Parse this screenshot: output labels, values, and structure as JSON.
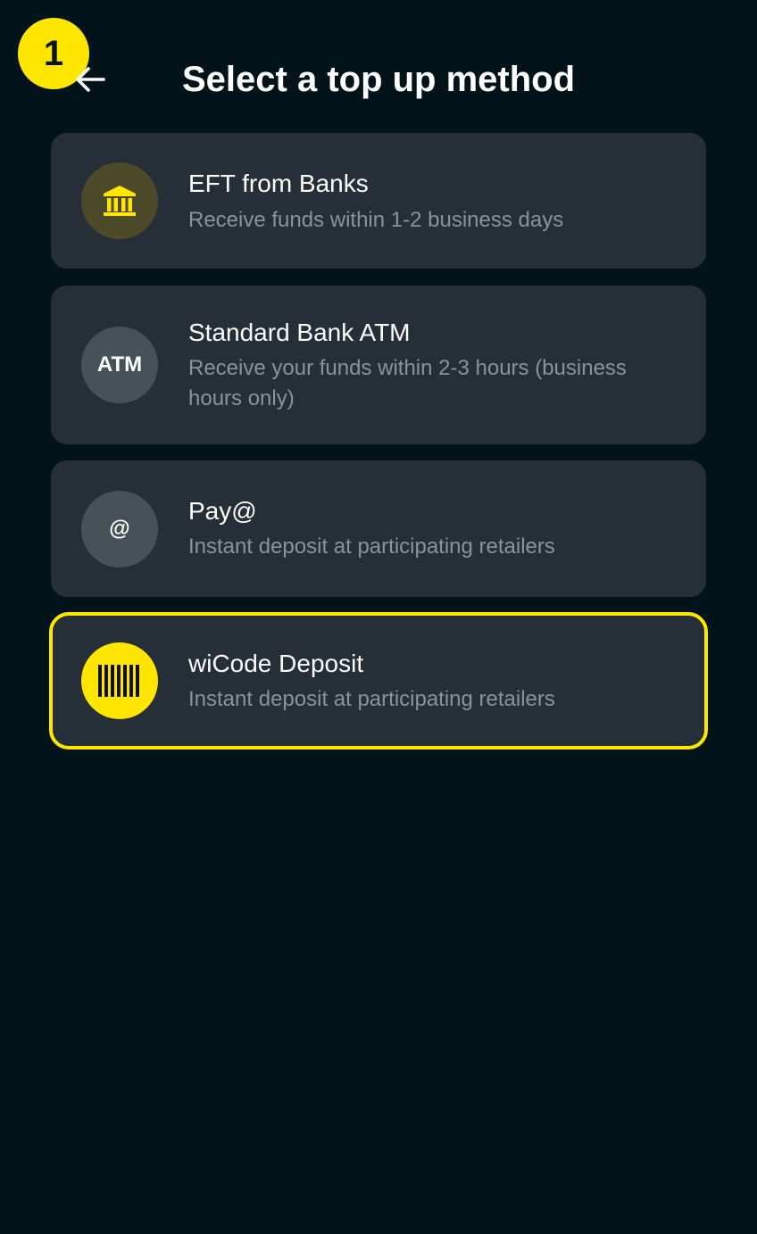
{
  "step_badge": "1",
  "header": {
    "title": "Select a top up method",
    "back_icon": "arrow-left-icon"
  },
  "methods": [
    {
      "id": "eft",
      "title": "EFT from Banks",
      "description": "Receive funds within 1-2 business days",
      "icon": "bank-icon",
      "icon_bg": "#4d4a2a",
      "icon_color": "#ffe600",
      "selected": false
    },
    {
      "id": "atm",
      "title": "Standard Bank ATM",
      "description": "Receive your funds within 2-3 hours (business hours only)",
      "icon": "atm-icon",
      "icon_text": "ATM",
      "icon_bg": "#465158",
      "selected": false
    },
    {
      "id": "payat",
      "title": "Pay@",
      "description": "Instant deposit at participating retailers",
      "icon": "at-sign-icon",
      "icon_text": "@",
      "icon_bg": "#465158",
      "selected": false
    },
    {
      "id": "wicode",
      "title": "wiCode Deposit",
      "description": "Instant deposit at participating retailers",
      "icon": "barcode-icon",
      "icon_bg": "#ffe600",
      "selected": true
    }
  ],
  "colors": {
    "background": "#02131a",
    "card": "#262f37",
    "accent": "#ffe600",
    "title_text": "#ffffff",
    "secondary_text": "#8a939a"
  }
}
